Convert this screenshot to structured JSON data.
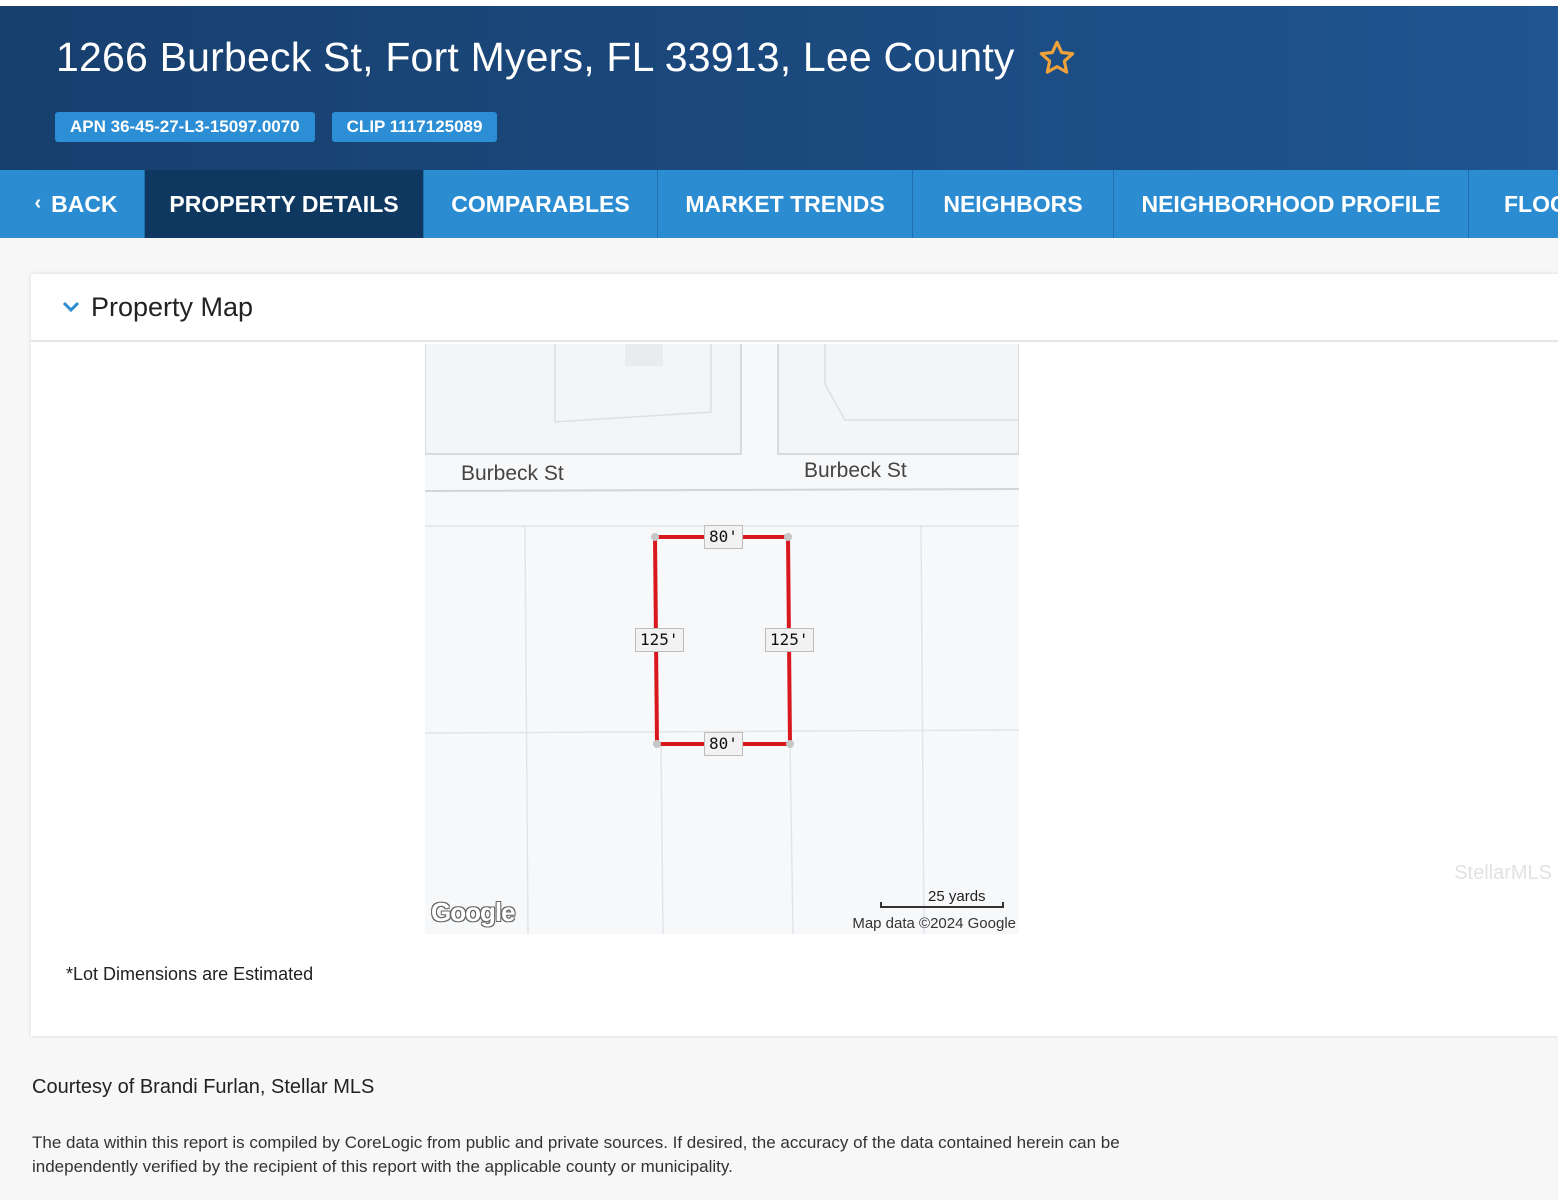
{
  "header": {
    "title": "1266 Burbeck St, Fort Myers, FL 33913, Lee County",
    "apn": "APN 36-45-27-L3-15097.0070",
    "clip": "CLIP 1117125089",
    "favorite_icon": "star-outline-icon",
    "colors": {
      "background": "#1b4a7f",
      "badge": "#2c8ed4",
      "star": "#f0a23a"
    }
  },
  "nav": {
    "back_label": "BACK",
    "tabs": [
      {
        "label": "PROPERTY DETAILS",
        "active": true
      },
      {
        "label": "COMPARABLES",
        "active": false
      },
      {
        "label": "MARKET TRENDS",
        "active": false
      },
      {
        "label": "NEIGHBORS",
        "active": false
      },
      {
        "label": "NEIGHBORHOOD PROFILE",
        "active": false
      },
      {
        "label": "FLOC",
        "active": false
      }
    ],
    "colors": {
      "bar": "#2b8cd1",
      "active": "#0f3861"
    }
  },
  "property_map": {
    "section_title": "Property Map",
    "street_label_left": "Burbeck St",
    "street_label_right": "Burbeck St",
    "dimensions": {
      "top": "80'",
      "bottom": "80'",
      "left": "125'",
      "right": "125'"
    },
    "logo_text": "Google",
    "scale_label": "25 yards",
    "attribution": "Map data ©2024 Google",
    "watermark": "StellarMLS",
    "footnote": "*Lot Dimensions are Estimated",
    "colors": {
      "lot_outline": "#d9181e"
    }
  },
  "footer": {
    "courtesy": "Courtesy of Brandi Furlan, Stellar MLS",
    "disclaimer": "The data within this report is compiled by CoreLogic from public and private sources. If desired, the accuracy of the data contained herein can be independently verified by the recipient of this report with the applicable county or municipality."
  }
}
